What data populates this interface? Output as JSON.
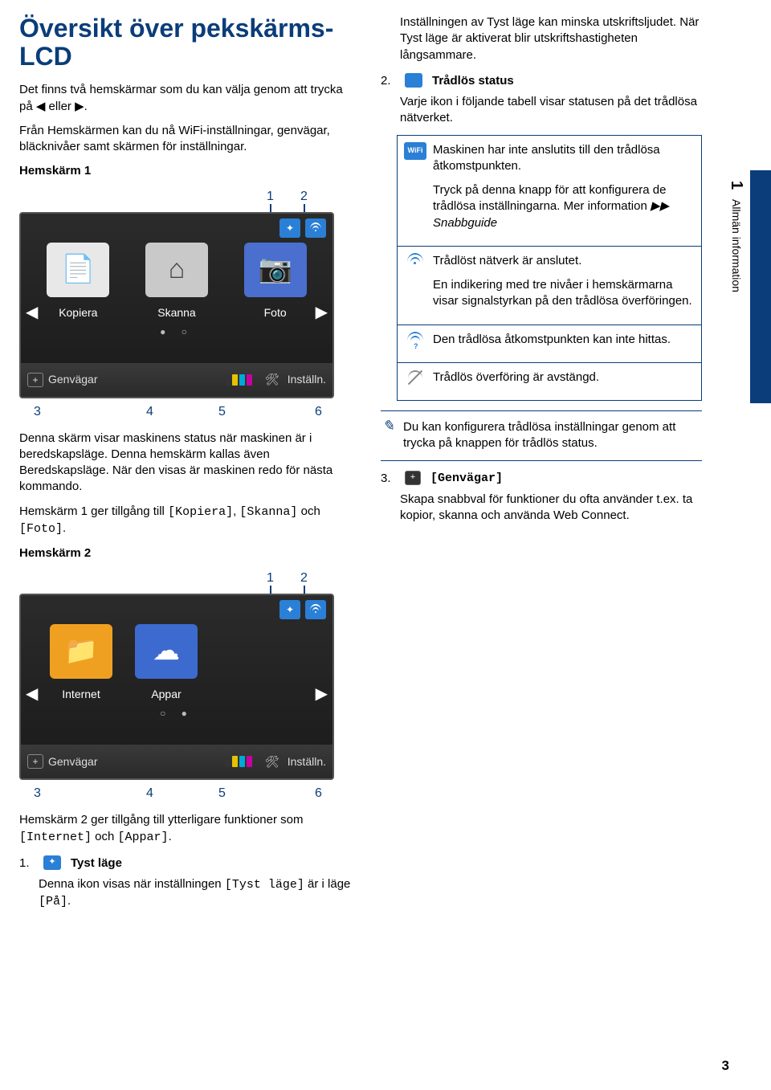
{
  "title": "Översikt över pekskärms-LCD",
  "intro1": "Det finns två hemskärmar som du kan välja genom att trycka på ◀ eller ▶.",
  "intro2": "Från Hemskärmen kan du nå WiFi-inställningar, genvägar, bläcknivåer samt skärmen för inställningar.",
  "hem1_label": "Hemskärm 1",
  "callouts": {
    "c1": "1",
    "c2": "2",
    "c3": "3",
    "c4": "4",
    "c5": "5",
    "c6": "6"
  },
  "lcd1": {
    "items": [
      "Kopiera",
      "Skanna",
      "Foto"
    ],
    "bottom_left": "Genvägar",
    "bottom_right": "Inställn."
  },
  "status_desc": "Denna skärm visar maskinens status när maskinen är i beredskapsläge. Denna hemskärm kallas även Beredskapsläge. När den visas är maskinen redo för nästa kommando.",
  "hem1_gives": "Hemskärm 1 ger tillgång till ",
  "hem1_codes": [
    "[Kopiera]",
    "[Skanna]",
    "[Foto]"
  ],
  "och": " och ",
  "dot": ".",
  "hem2_label": "Hemskärm 2",
  "lcd2": {
    "items": [
      "Internet",
      "Appar"
    ],
    "bottom_left": "Genvägar",
    "bottom_right": "Inställn."
  },
  "hem2_gives": "Hemskärm 2 ger tillgång till ytterligare funktioner som ",
  "hem2_codes": [
    "[Internet]",
    "[Appar]"
  ],
  "item1_num": "1.",
  "item1_title": "Tyst läge",
  "item1_text_a": "Denna ikon visas när inställningen ",
  "item1_code": "[Tyst läge]",
  "item1_text_b": " är i läge ",
  "item1_code2": "[På]",
  "quiet_desc": "Inställningen av Tyst läge kan minska utskriftsljudet. När Tyst läge är aktiverat blir utskriftshastigheten långsammare.",
  "item2_num": "2.",
  "item2_title": "Trådlös status",
  "item2_text": "Varje ikon i följande tabell visar statusen på det trådlösa nätverket.",
  "wifi_rows": [
    {
      "icon": "WiFi",
      "text_a": "Maskinen har inte anslutits till den trådlösa åtkomstpunkten.",
      "text_b": "Tryck på denna knapp för att konfigurera de trådlösa inställningarna. Mer information ",
      "ref": "▶▶ Snabbguide"
    },
    {
      "icon": "sig",
      "text_a": "Trådlöst nätverk är anslutet.",
      "text_b": "En indikering med tre nivåer i hemskärmarna visar signalstyrkan på den trådlösa överföringen."
    },
    {
      "icon": "q",
      "text_a": "Den trådlösa åtkomstpunkten kan inte hittas."
    },
    {
      "icon": "off",
      "text_a": "Trådlös överföring är avstängd."
    }
  ],
  "note_text": "Du kan konfigurera trådlösa inställningar genom att trycka på knappen för trådlös status.",
  "item3_num": "3.",
  "item3_title": "[Genvägar]",
  "item3_text": "Skapa snabbval för funktioner du ofta använder t.ex. ta kopior, skanna och använda Web Connect.",
  "side": {
    "chapter": "1",
    "label": "Allmän information"
  },
  "pagenum": "3"
}
